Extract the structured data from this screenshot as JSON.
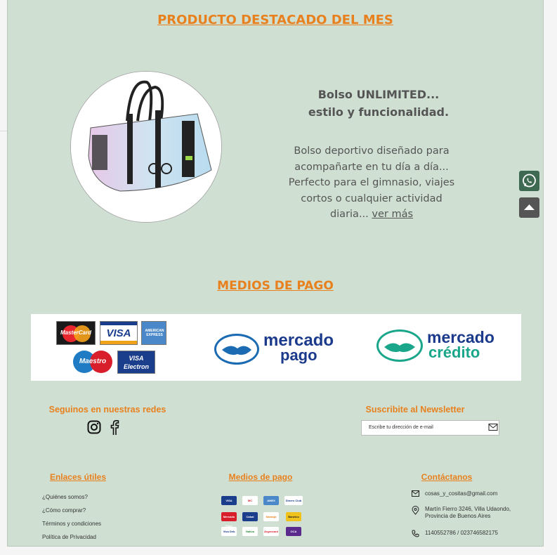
{
  "featured": {
    "heading": "PRODUCTO DESTACADO DEL MES",
    "title_line1": "Bolso UNLIMITED...",
    "title_line2": "estilo y funcionalidad.",
    "description": "Bolso deportivo diseñado para acompañarte en tu día a día... Perfecto para el gimnasio, viajes cortos o cualquier actividad diaria...",
    "more_link": "ver más"
  },
  "payment": {
    "heading": "MEDIOS DE PAGO",
    "cards": [
      "MasterCard",
      "VISA",
      "AMERICAN EXPRESS",
      "Maestro",
      "VISA Electron"
    ],
    "mp_line1": "mercado",
    "mp_line2": "pago",
    "mc_line1": "mercado",
    "mc_line2": "crédito"
  },
  "social": {
    "heading": "Seguinos en nuestras redes"
  },
  "newsletter": {
    "heading": "Suscribite al Newsletter",
    "placeholder": "Escribe tu dirección de e-mail"
  },
  "footer": {
    "links_heading": "Enlaces útiles",
    "links": [
      "¿Quiénes somos?",
      "¿Cómo comprar?",
      "Términos y condiciones",
      "Política de Privacidad"
    ],
    "payments_heading": "Medios de pago",
    "payment_chips": [
      "VISA",
      "MC",
      "AMEX",
      "Diners Club",
      "Mercado Pago",
      "Cabal",
      "Naranja",
      "Banelco",
      "Visa Deb",
      "Nativa",
      "Argencard",
      "OCA"
    ],
    "contact_heading": "Contáctanos",
    "email": "cosas_y_cositas@gmail.com",
    "address_line1": "Martín Fierro 3246, Villa Udaondo,",
    "address_line2": "Provincia de Buenos Aires",
    "phone": "1140552786 / 023746582175"
  },
  "colors": {
    "accent": "#e8801e",
    "panel": "#cfe0d3"
  }
}
